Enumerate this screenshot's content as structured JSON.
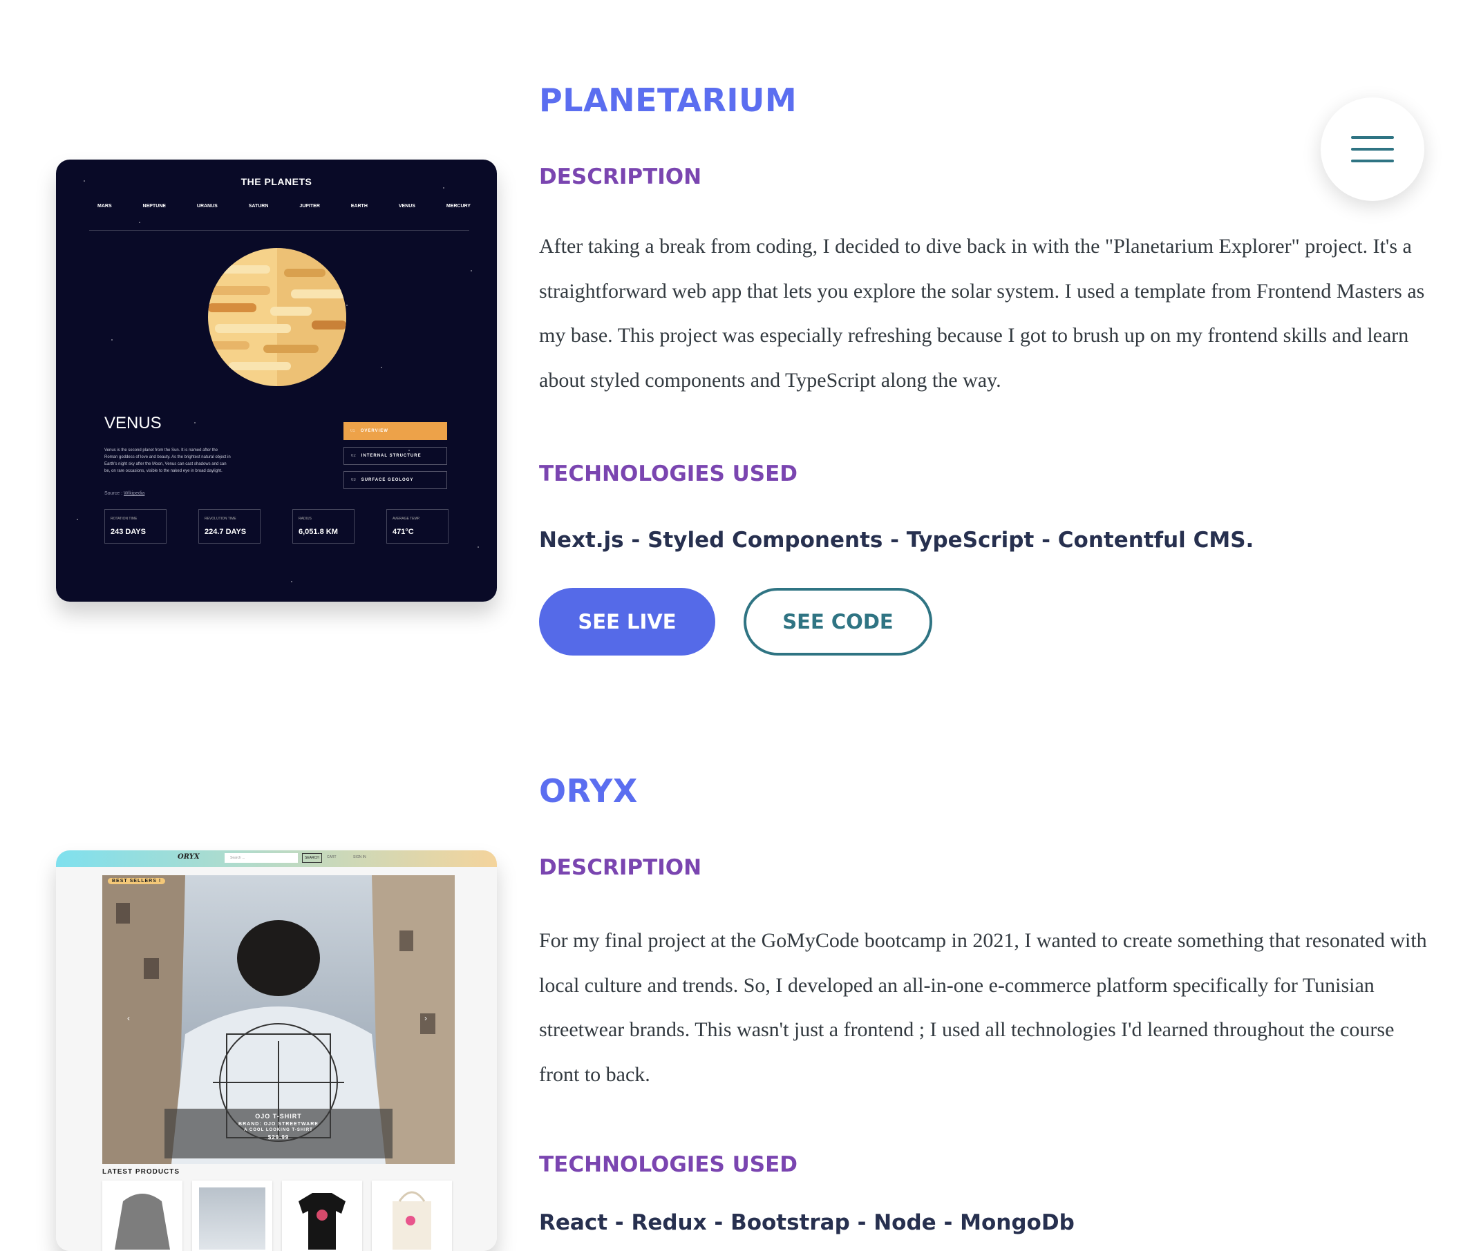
{
  "nav": {
    "menu_icon": "hamburger-menu-icon"
  },
  "projects": [
    {
      "title": "PLANETARIUM",
      "description_heading": "DESCRIPTION",
      "description": "After taking a break from coding, I decided to dive back in with the \"Planetarium Explorer\" project. It's a straightforward web app that lets you explore the solar system. I used a template from Frontend Masters as my base. This project was especially refreshing because I got to brush up on my frontend skills and learn about styled components and TypeScript along the way.",
      "tech_heading": "TECHNOLOGIES USED",
      "technologies": "Next.js - Styled Components - TypeScript - Contentful CMS.",
      "live_label": "SEE LIVE",
      "code_label": "SEE CODE",
      "screenshot": {
        "brand": "THE PLANETS",
        "nav": [
          "MARS",
          "NEPTUNE",
          "URANUS",
          "SATURN",
          "JUPITER",
          "EARTH",
          "VENUS",
          "MERCURY"
        ],
        "planet_name": "VENUS",
        "planet_text": "Venus is the second planet from the Sun. It is named after the Roman goddess of love and beauty. As the brightest natural object in Earth's night sky after the Moon, Venus can cast shadows and can be, on rare occasions, visible to the naked eye in broad daylight.",
        "source_label": "Source :",
        "source_link": "Wikipedia",
        "tabs": [
          {
            "num": "01",
            "label": "OVERVIEW"
          },
          {
            "num": "02",
            "label": "INTERNAL STRUCTURE"
          },
          {
            "num": "03",
            "label": "SURFACE GEOLOGY"
          }
        ],
        "stats": [
          {
            "label": "ROTATION TIME",
            "value": "243 DAYS"
          },
          {
            "label": "REVOLUTION TIME",
            "value": "224.7 DAYS"
          },
          {
            "label": "RADIUS",
            "value": "6,051.8 KM"
          },
          {
            "label": "AVERAGE TEMP.",
            "value": "471°C"
          }
        ],
        "accent": "#eda249"
      }
    },
    {
      "title": "ORYX",
      "description_heading": "DESCRIPTION",
      "description": "For my final project at the GoMyCode bootcamp in 2021, I wanted to create something that resonated with local culture and trends. So, I developed an all-in-one e-commerce platform specifically for Tunisian streetwear brands. This wasn't just a frontend ; I used all technologies I'd learned throughout the course front to back.",
      "tech_heading": "TECHNOLOGIES USED",
      "technologies": "React - Redux - Bootstrap - Node - MongoDb",
      "screenshot": {
        "logo": "ORYX",
        "search_placeholder": "Search ...",
        "search_btn": "SEARCH",
        "cart": "CART",
        "signin": "SIGN IN",
        "badge": "BEST SELLERS !",
        "product_name": "OJO T-SHIRT",
        "product_brand": "BRAND: OJO STREETWARE",
        "product_desc": "A COOL LOOKING T-SHIRT",
        "product_price": "$29.99",
        "latest": "LATEST PRODUCTS"
      }
    }
  ]
}
